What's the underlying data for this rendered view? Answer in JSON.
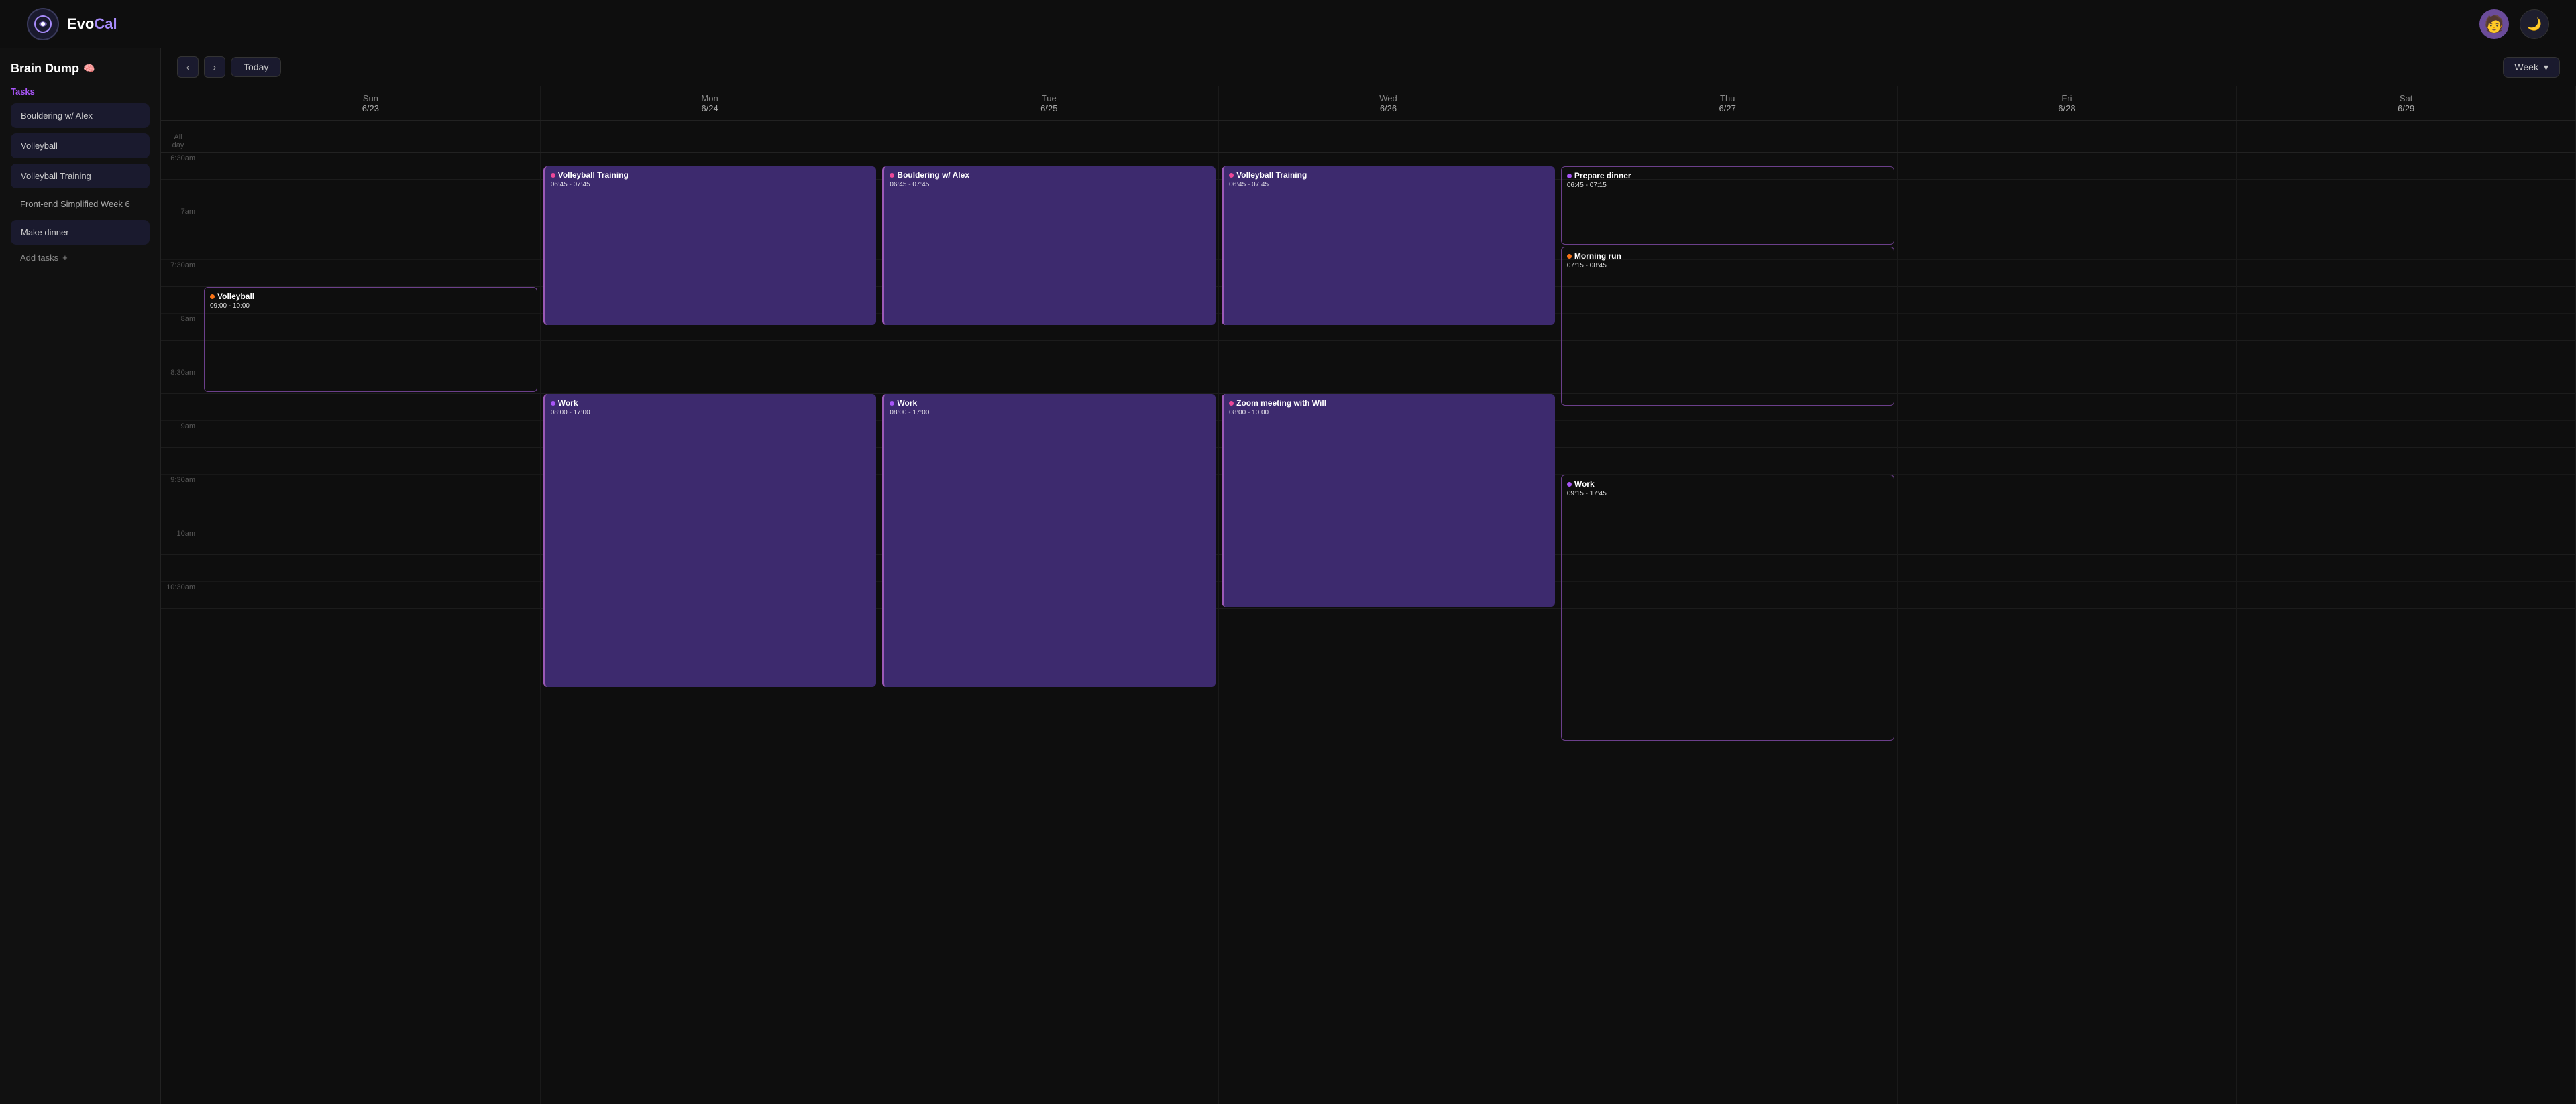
{
  "header": {
    "logo_evo": "Evo",
    "logo_cal": "Cal",
    "title": "EvoCal"
  },
  "sidebar": {
    "brain_dump": "Brain Dump",
    "brain_emoji": "🧠",
    "tasks_label": "Tasks",
    "tasks": [
      {
        "id": 1,
        "label": "Bouldering w/ Alex",
        "has_bg": true
      },
      {
        "id": 2,
        "label": "Volleyball",
        "has_bg": true
      },
      {
        "id": 3,
        "label": "Volleyball Training",
        "has_bg": true
      },
      {
        "id": 4,
        "label": "Front-end Simplified Week 6",
        "has_bg": false
      },
      {
        "id": 5,
        "label": "Make dinner",
        "has_bg": true
      }
    ],
    "add_tasks_label": "Add tasks",
    "add_icon": "+"
  },
  "toolbar": {
    "today_label": "Today",
    "prev_label": "‹",
    "next_label": "›",
    "view_label": "Week",
    "dropdown_icon": "▾"
  },
  "calendar": {
    "days": [
      {
        "name": "Sun",
        "date": "6/23"
      },
      {
        "name": "Mon",
        "date": "6/24"
      },
      {
        "name": "Tue",
        "date": "6/25"
      },
      {
        "name": "Wed",
        "date": "6/26"
      },
      {
        "name": "Thu",
        "date": "6/27"
      },
      {
        "name": "Fri",
        "date": "6/28"
      },
      {
        "name": "Sat",
        "date": "6/29"
      }
    ],
    "all_day_label": "All",
    "all_day_sublabel": "day",
    "time_slots": [
      "6:30am",
      "",
      "7am",
      "",
      "7:30am",
      "",
      "8am",
      "",
      "8:30am",
      "",
      "9am",
      "",
      "9:30am",
      "",
      "10am",
      "",
      "10:30am",
      ""
    ],
    "events": {
      "mon": [
        {
          "title": "Volleyball Training",
          "time": "06:45 - 07:45",
          "style": "purple",
          "dot": "pink",
          "top_slot": 1,
          "height_slots": 6
        },
        {
          "title": "Work",
          "time": "08:00 - 17:00",
          "style": "purple",
          "dot": "purple",
          "top_slot": 9,
          "height_slots": 10
        }
      ],
      "tue": [
        {
          "title": "Bouldering w/ Alex",
          "time": "06:45 - 07:45",
          "style": "purple",
          "dot": "pink",
          "top_slot": 1,
          "height_slots": 6
        },
        {
          "title": "Work",
          "time": "08:00 - 17:00",
          "style": "purple",
          "dot": "purple",
          "top_slot": 9,
          "height_slots": 10
        }
      ],
      "wed": [
        {
          "title": "Volleyball Training",
          "time": "06:45 - 07:45",
          "style": "purple",
          "dot": "pink",
          "top_slot": 1,
          "height_slots": 6
        },
        {
          "title": "Zoom meeting with Will",
          "time": "08:00 - 10:00",
          "style": "purple",
          "dot": "pink",
          "top_slot": 9,
          "height_slots": 8
        }
      ],
      "thu": [
        {
          "title": "Prepare dinner",
          "time": "06:45 - 07:15",
          "style": "outline",
          "dot": "purple",
          "top_slot": 1,
          "height_slots": 3
        },
        {
          "title": "Morning run",
          "time": "07:15 - 08:45",
          "style": "outline",
          "dot": "orange",
          "top_slot": 4,
          "height_slots": 5
        },
        {
          "title": "Work",
          "time": "09:15 - 17:45",
          "style": "outline",
          "dot": "purple",
          "top_slot": 11,
          "height_slots": 10
        }
      ],
      "sun": [
        {
          "title": "Volleyball",
          "time": "09:00 - 10:00",
          "style": "outline",
          "dot": "orange",
          "top_slot": 10,
          "height_slots": 4
        }
      ]
    }
  },
  "colors": {
    "bg": "#0e0e0e",
    "sidebar_bg": "#111111",
    "accent_purple": "#a855f7",
    "event_purple_bg": "#3d2a6e",
    "event_outline_border": "#6b3f8a",
    "dot_pink": "#ec4899",
    "dot_purple": "#a855f7",
    "dot_orange": "#f97316"
  }
}
